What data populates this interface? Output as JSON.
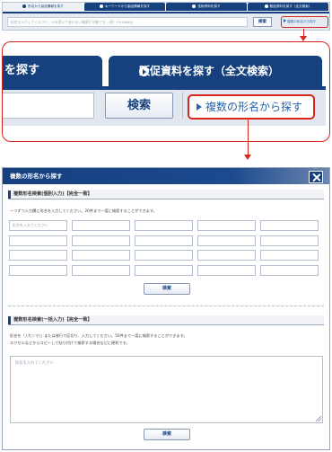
{
  "top_strip": {
    "tabs": [
      {
        "label": "形名から製品情報を探す",
        "active": true
      },
      {
        "label": "キーワードから製品情報を探す",
        "active": false
      },
      {
        "label": "技術資料を探す",
        "active": false
      },
      {
        "label": "販促資料を探す（全文検索）",
        "active": false
      }
    ],
    "search_placeholder": "形名を入力してください。%を用いてあいまい検索が可能です。(例：PU%BBQ)",
    "search_button": "検索",
    "multi_link": "複数の形名から探す"
  },
  "zoom": {
    "left_tab_label": "を探す",
    "right_tab_label": "販促資料を探す（全文検索）",
    "search_button": "検索",
    "multi_link": "複数の形名から探す"
  },
  "dialog": {
    "title": "複数の形名から探す",
    "section1": {
      "title": "複数形名検索(個別入力)【完全一致】",
      "description": "一つずつ入力欄に形名を入力してください。20件まで一度に検索することができます。",
      "first_placeholder": "形名を入れてください",
      "rows": 4,
      "cols": 5,
      "button": "検索"
    },
    "section2": {
      "title": "複数形名検索(一括入力)【完全一致】",
      "description_line1": "形名を「,(カンマ)」または改行で区切り、入力してください。50件まで一度に検索することができます。",
      "description_line2": "エクセルなどからコピーして貼り付けて検索する場合などに便利です。",
      "placeholder": "形名を入れてください",
      "button": "検索"
    }
  },
  "colors": {
    "navy": "#16407e",
    "highlight_red": "#d9261c",
    "link_blue": "#2a63a8"
  }
}
